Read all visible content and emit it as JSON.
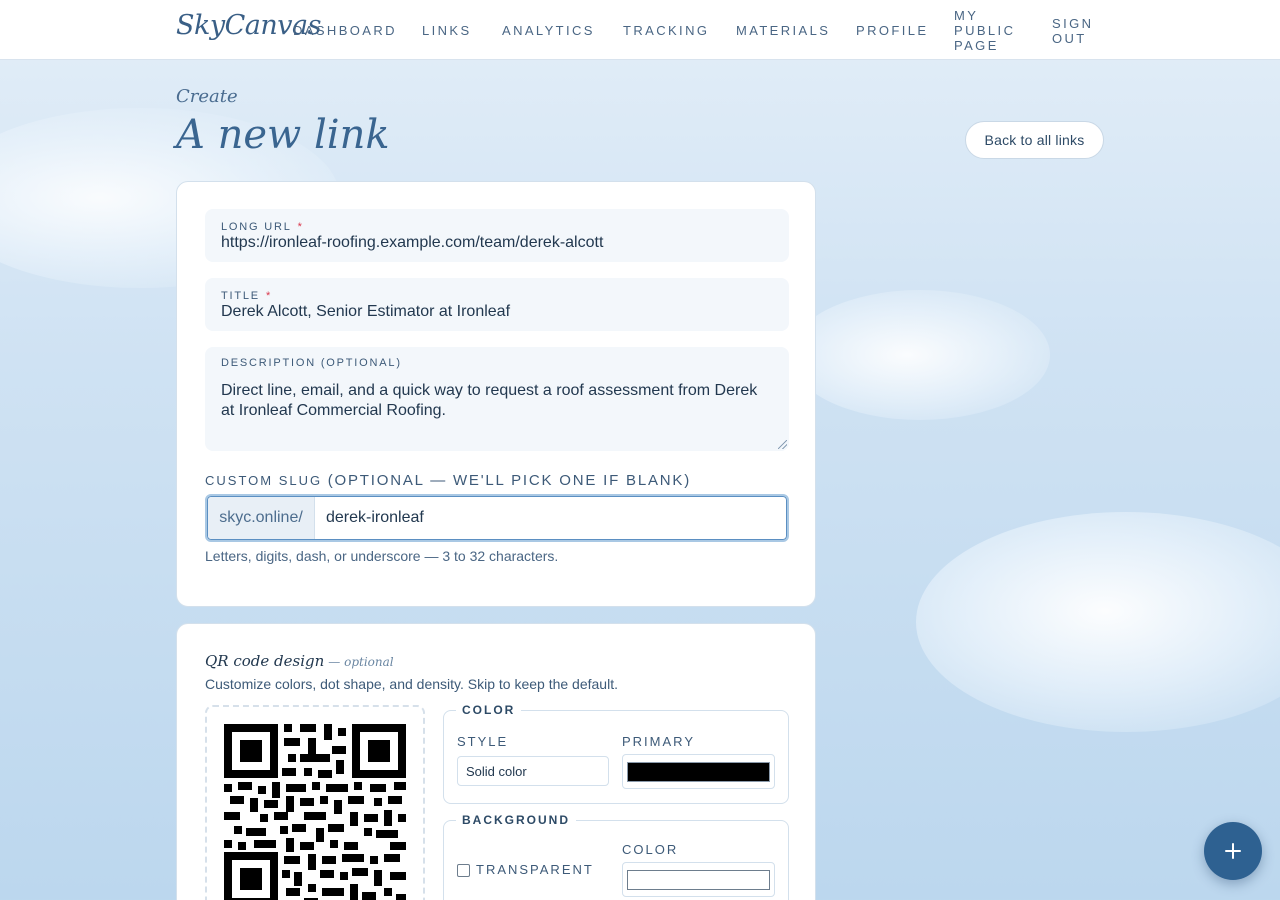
{
  "brand": {
    "logo": "SkyCanvas"
  },
  "nav": {
    "dashboard": "DASHBOARD",
    "links": "LINKS",
    "analytics": "ANALYTICS",
    "tracking": "TRACKING",
    "materials": "MATERIALS",
    "profile": "PROFILE",
    "public_page": [
      "MY",
      "PUBLIC",
      "PAGE"
    ],
    "sign_out": [
      "SIGN",
      "OUT"
    ]
  },
  "page": {
    "crumb": "Create",
    "title": "A new link",
    "back_button": "Back to all links"
  },
  "form": {
    "long_url": {
      "label": "LONG URL",
      "required_mark": "*",
      "value": "https://ironleaf-roofing.example.com/team/derek-alcott"
    },
    "title": {
      "label": "TITLE",
      "required_mark": "*",
      "value": "Derek Alcott, Senior Estimator at Ironleaf"
    },
    "description": {
      "label": "DESCRIPTION (OPTIONAL)",
      "value": "Direct line, email, and a quick way to request a roof assessment from Derek at Ironleaf Commercial Roofing."
    },
    "slug": {
      "label": "CUSTOM SLUG",
      "label_optional": "(OPTIONAL — WE'LL PICK ONE IF BLANK)",
      "prefix": "skyc.online/",
      "value": "derek-ironleaf",
      "hint": "Letters, digits, dash, or underscore — 3 to 32 characters."
    }
  },
  "qr": {
    "heading": "QR code design",
    "heading_optional": "— optional",
    "subtitle": "Customize colors, dot shape, and density. Skip to keep the default.",
    "color_group": {
      "legend": "COLOR",
      "style_label": "STYLE",
      "style_value": "Solid color",
      "primary_label": "PRIMARY",
      "primary_color": "#000000"
    },
    "background_group": {
      "legend": "BACKGROUND",
      "transparent_label": "TRANSPARENT",
      "transparent_checked": false,
      "color_label": "COLOR",
      "color_value": "#ffffff"
    }
  },
  "fab": {
    "icon": "plus-icon"
  },
  "colors": {
    "accent": "#2e6191",
    "required": "#d9384c",
    "text": "#2d4a66"
  }
}
